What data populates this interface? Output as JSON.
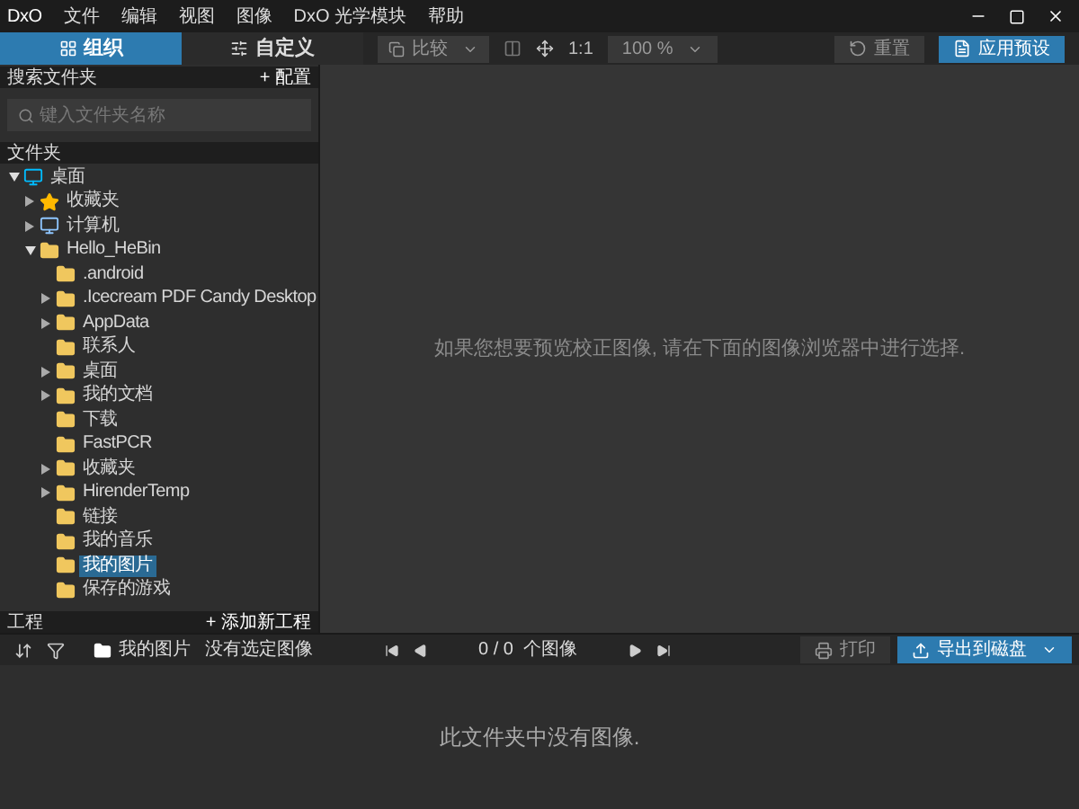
{
  "window": {
    "logo": "DxO"
  },
  "menu": [
    "文件",
    "编辑",
    "视图",
    "图像",
    "DxO 光学模块",
    "帮助"
  ],
  "tabs": [
    {
      "label": "组织",
      "selected": true
    },
    {
      "label": "自定义",
      "selected": false
    }
  ],
  "toolbar": {
    "compare": "比较",
    "ratio": "1:1",
    "zoom": "100 %",
    "reset": "重置",
    "apply_preset": "应用预设"
  },
  "folder_search": {
    "title": "搜索文件夹",
    "config": "+ 配置",
    "placeholder": "键入文件夹名称"
  },
  "folders": {
    "title": "文件夹",
    "tree": [
      {
        "label": "桌面",
        "kind": "desktop",
        "expanded": true,
        "selected": false,
        "children": [
          {
            "label": "收藏夹",
            "kind": "star",
            "expanded": false,
            "selected": false
          },
          {
            "label": "计算机",
            "kind": "computer",
            "expanded": false,
            "selected": false
          },
          {
            "label": "Hello_HeBin",
            "kind": "folder",
            "expanded": true,
            "selected": false,
            "children": [
              {
                "label": ".android",
                "kind": "folder",
                "selected": false
              },
              {
                "label": ".Icecream PDF Candy Desktop",
                "kind": "folder",
                "expanded": false,
                "selected": false
              },
              {
                "label": "AppData",
                "kind": "folder",
                "expanded": false,
                "selected": false
              },
              {
                "label": "联系人",
                "kind": "folder",
                "selected": false
              },
              {
                "label": "桌面",
                "kind": "folder",
                "expanded": false,
                "selected": false
              },
              {
                "label": "我的文档",
                "kind": "folder",
                "expanded": false,
                "selected": false
              },
              {
                "label": "下载",
                "kind": "folder",
                "selected": false
              },
              {
                "label": "FastPCR",
                "kind": "folder",
                "selected": false
              },
              {
                "label": "收藏夹",
                "kind": "folder",
                "expanded": false,
                "selected": false
              },
              {
                "label": "HirenderTemp",
                "kind": "folder",
                "expanded": false,
                "selected": false
              },
              {
                "label": "链接",
                "kind": "folder",
                "selected": false
              },
              {
                "label": "我的音乐",
                "kind": "folder",
                "selected": false
              },
              {
                "label": "我的图片",
                "kind": "folder",
                "selected": true
              },
              {
                "label": "保存的游戏",
                "kind": "folder",
                "selected": false
              }
            ]
          }
        ]
      }
    ]
  },
  "viewer": {
    "message": "如果您想要预览校正图像, 请在下面的图像浏览器中进行选择."
  },
  "projects": {
    "title": "工程",
    "add": "+ 添加新工程"
  },
  "browser_bar": {
    "path": "我的图片",
    "status": "没有选定图像",
    "counter": "0 / 0  个图像",
    "print": "打印",
    "export": "导出到磁盘"
  },
  "browser": {
    "message": "此文件夹中没有图像."
  }
}
